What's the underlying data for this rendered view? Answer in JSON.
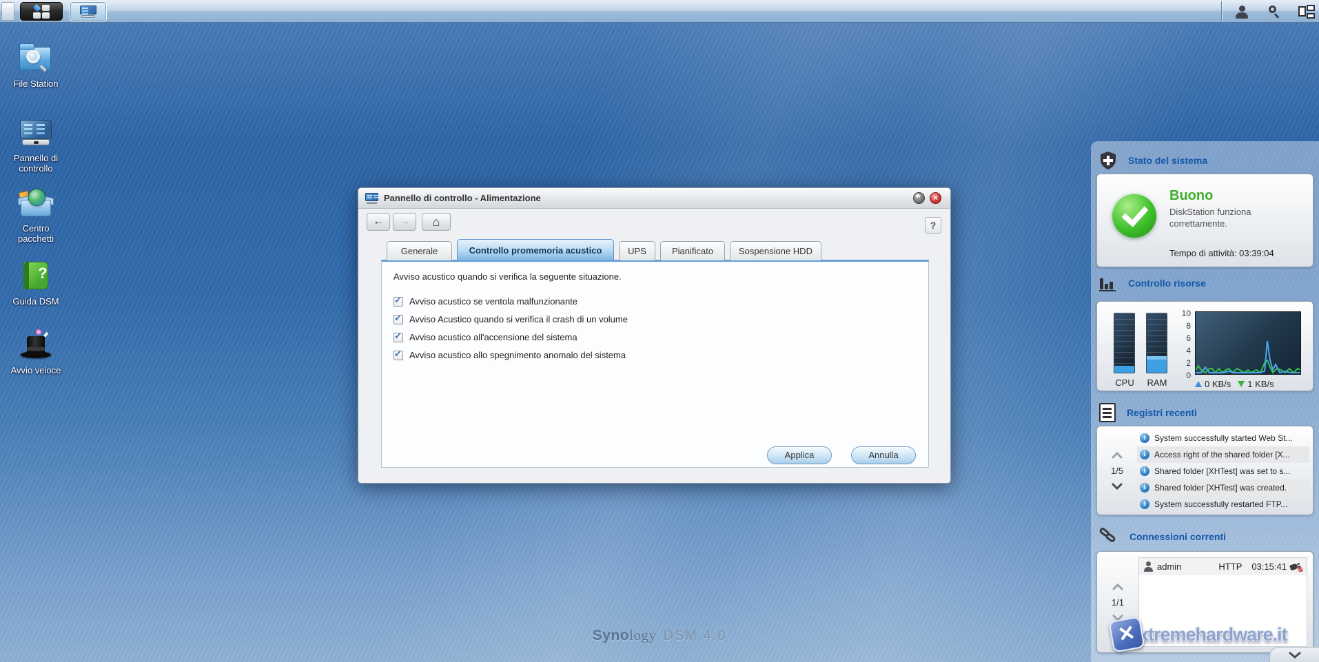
{
  "window": {
    "title": "Pannello di controllo - Alimentazione",
    "back_glyph": "←",
    "forward_glyph": "→",
    "home_glyph": "⌂",
    "minimize_glyph": "",
    "close_glyph": "×",
    "help_label": "?",
    "tabs": [
      {
        "label": "Generale"
      },
      {
        "label": "Controllo promemoria acustico"
      },
      {
        "label": "UPS"
      },
      {
        "label": "Pianificato"
      },
      {
        "label": "Sospensione HDD"
      }
    ],
    "active_tab": "Controllo promemoria acustico",
    "intro_text": "Avviso acustico quando si verifica la seguente situazione.",
    "checkboxes": [
      {
        "label": "Avviso acustico se ventola malfunzionante",
        "checked": true
      },
      {
        "label": "Avviso Acustico quando si verifica il crash di un volume",
        "checked": true
      },
      {
        "label": "Avviso acustico all'accensione del sistema",
        "checked": true
      },
      {
        "label": "Avviso acustico allo spegnimento anomalo del sistema",
        "checked": true
      }
    ],
    "apply_label": "Applica",
    "cancel_label": "Annulla"
  },
  "desktop_icons": [
    {
      "label": "File Station",
      "icon": "folder-search-icon"
    },
    {
      "label": "Pannello di controllo",
      "icon": "control-panel-icon"
    },
    {
      "label": "Centro pacchetti",
      "icon": "package-box-icon"
    },
    {
      "label": "Guida DSM",
      "icon": "help-book-icon"
    },
    {
      "label": "Avvio veloce",
      "icon": "magic-hat-icon"
    }
  ],
  "sidebar": {
    "system_status": {
      "title": "Stato del sistema",
      "status": "Buono",
      "status_color": "#3fae29",
      "description": "DiskStation funziona correttamente.",
      "uptime": "Tempo di attività: 03:39:04"
    },
    "resource_monitor": {
      "title": "Controllo risorse",
      "cpu_label": "CPU",
      "ram_label": "RAM",
      "cpu_percent": 11,
      "ram_percent": 22,
      "axis_ticks": [
        "10",
        "8",
        "6",
        "4",
        "2",
        "0"
      ],
      "upload": "0 KB/s",
      "download": "1 KB/s"
    },
    "recent_logs": {
      "title": "Registri recenti",
      "pager": "1/5",
      "items": [
        "System successfully started Web St...",
        "Access right of the shared folder [X...",
        "Shared folder [XHTest] was set to s...",
        "Shared folder [XHTest] was created.",
        "System successfully restarted FTP..."
      ]
    },
    "connections": {
      "title": "Connessioni correnti",
      "pager": "1/1",
      "rows": [
        {
          "user": "admin",
          "protocol": "HTTP",
          "time": "03:15:41"
        }
      ]
    }
  },
  "watermark": {
    "brand_a": "Syno",
    "brand_b": "logy",
    "version": "DSM 4.0"
  },
  "site_watermark": "xtremehardware.it"
}
